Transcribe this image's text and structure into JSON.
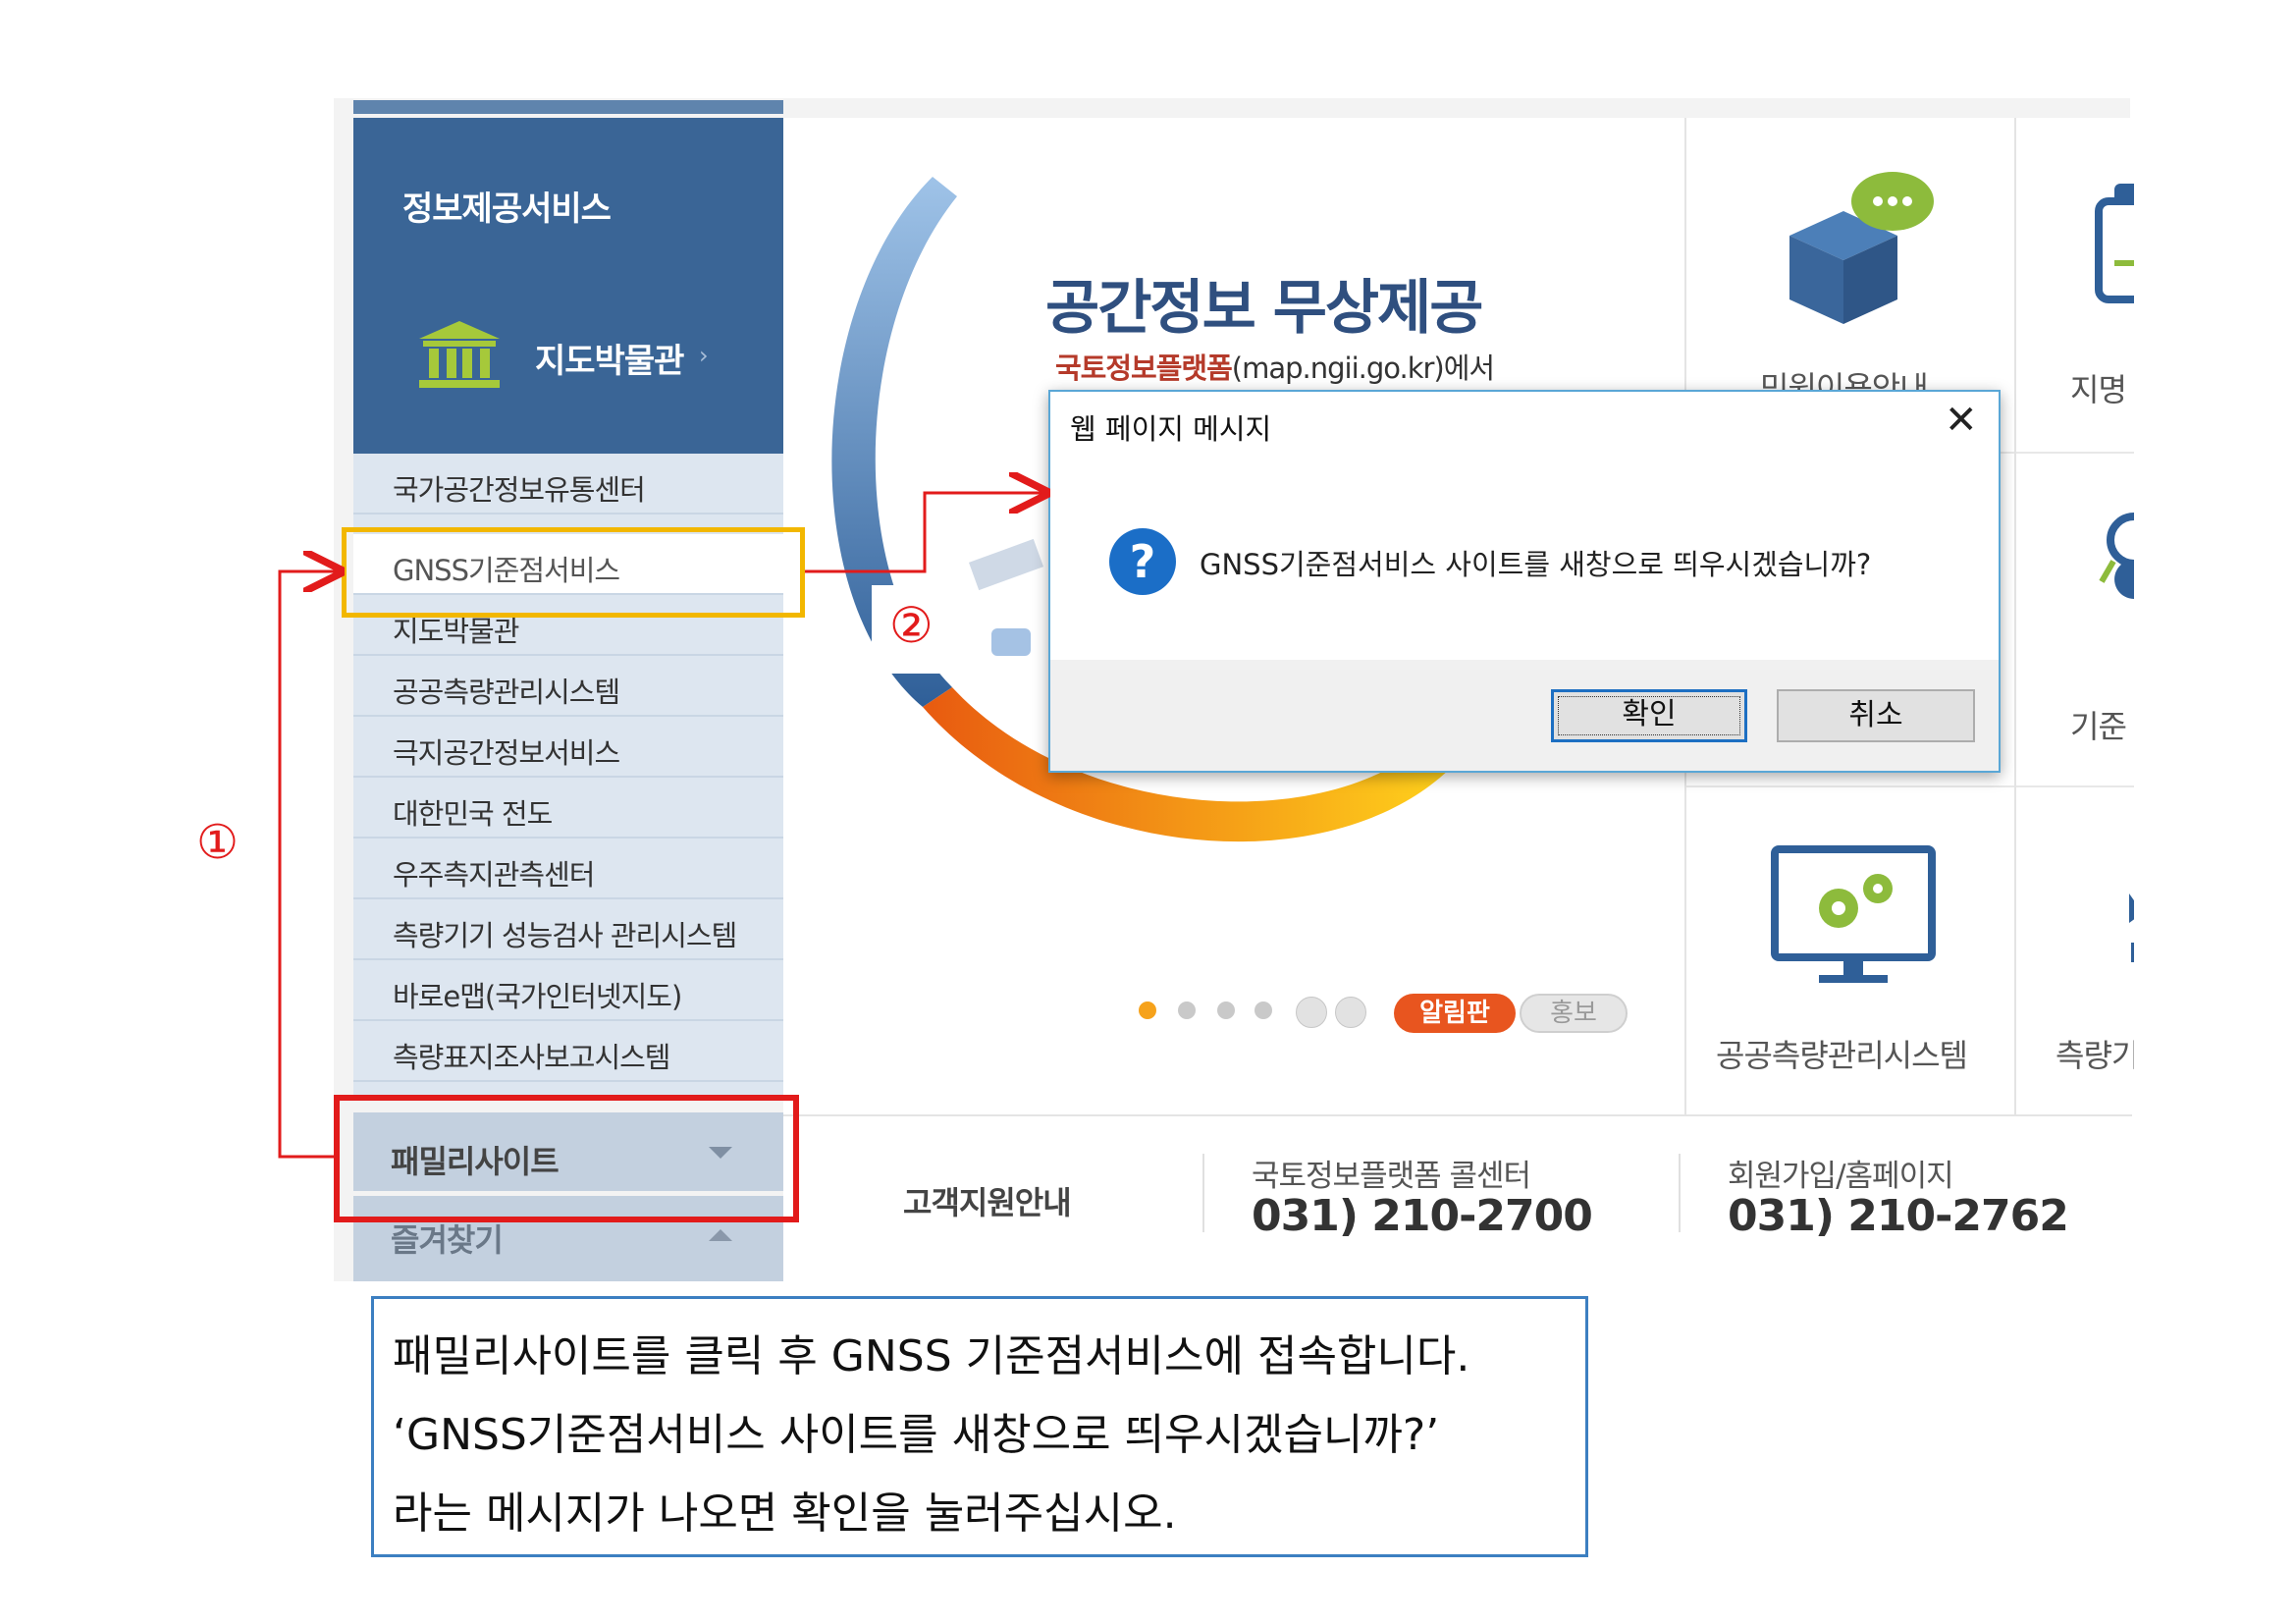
{
  "sidebar": {
    "title": "정보제공서비스",
    "museum_label": "지도박물관",
    "museum_arrow": "›",
    "items": [
      {
        "label": "국가공간정보유통센터"
      },
      {
        "label": "GNSS기준점서비스"
      },
      {
        "label": "지도박물관"
      },
      {
        "label": "공공측량관리시스템"
      },
      {
        "label": "극지공간정보서비스"
      },
      {
        "label": "대한민국 전도"
      },
      {
        "label": "우주측지관측센터"
      },
      {
        "label": "측량기기 성능검사 관리시스템"
      },
      {
        "label": "바로e맵(국가인터넷지도)"
      },
      {
        "label": "측량표지조사보고시스템"
      }
    ],
    "family_site": "패밀리사이트",
    "favorites": "즐겨찾기"
  },
  "banner": {
    "title": "공간정보 무상제공",
    "subtitle_emphasis": "국토정보플랫폼",
    "subtitle_rest": "(map.ngii.go.kr)에서",
    "notice_pill": "알림판",
    "pr_pill": "홍보"
  },
  "right_columns": {
    "col_a_top_label": "민원이용안내",
    "col_a_bottom_label": "공공측량관리시스템",
    "col_b_top_label": "지명",
    "col_b_mid_label": "기준",
    "col_b_bottom_label": "측량기"
  },
  "bottom_bar": {
    "support": "고객지원안내",
    "callcenter_label": "국토정보플랫폼 콜센터",
    "callcenter_phone": "031) 210-2700",
    "join_label": "회원가입/홈페이지",
    "join_phone": "031) 210-2762"
  },
  "dialog": {
    "title": "웹 페이지 메시지",
    "close": "✕",
    "question_icon": "?",
    "message": "GNSS기준점서비스 사이트를 새창으로 띄우시겠습니까?",
    "ok": "확인",
    "cancel": "취소"
  },
  "annotations": {
    "step1": "①",
    "step2": "②",
    "highlight_color_yellow": "#f2b700",
    "highlight_color_red": "#e21b1b"
  },
  "caption": {
    "line1": "패밀리사이트를 클릭 후 GNSS 기준점서비스에 접속합니다.",
    "line2": "‘GNSS기준점서비스 사이트를 새창으로 띄우시겠습니까?’",
    "line3": "라는 메시지가 나오면 확인을 눌러주십시오."
  },
  "colors": {
    "sidebar_blue": "#3a6596",
    "sidebar_list": "#dde6f0",
    "dialog_accent": "#1d6fc2",
    "notice_orange": "#e8551f"
  }
}
